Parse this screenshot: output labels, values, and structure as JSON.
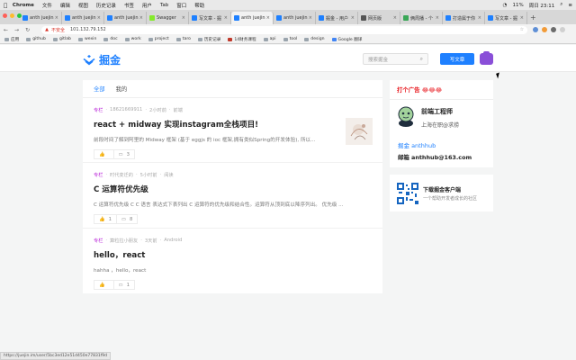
{
  "macbar": {
    "app": "Chrome",
    "menus": [
      "文件",
      "编辑",
      "视图",
      "历史记录",
      "书签",
      "用户",
      "Tab",
      "窗口",
      "帮助"
    ],
    "battery": "11%",
    "clock": "周日 23:11"
  },
  "tabs": [
    {
      "label": "anth juejin"
    },
    {
      "label": "anth juejin"
    },
    {
      "label": "anth juejin"
    },
    {
      "label": "Swagger"
    },
    {
      "label": "写文章 - 掘"
    },
    {
      "label": "anth juejin"
    },
    {
      "label": "anth juejin"
    },
    {
      "label": "掘金 - 用户"
    },
    {
      "label": "网页版"
    },
    {
      "label": "俩周播 - 个"
    },
    {
      "label": "打造属于你"
    },
    {
      "label": "写文章 - 掘"
    }
  ],
  "toolbar": {
    "security_label": "不安全",
    "url": "101.132.79.152"
  },
  "bookmarks": [
    "应用",
    "github",
    "gitlab",
    "wexin",
    "doc",
    "work",
    "project",
    "taro",
    "历史记录",
    "14财务课程",
    "api",
    "tool",
    "design",
    "Google 翻译"
  ],
  "header": {
    "logo_text": "掘金",
    "search_placeholder": "搜索掘金",
    "write_button": "写文章"
  },
  "feed": {
    "tabs": [
      "全部",
      "我的"
    ],
    "entries": [
      {
        "tag": "专栏",
        "author": "18621669911",
        "time": "2小时前",
        "category": "前端",
        "title": "react + midway 实现instagram全栈项目!",
        "abstract": "前段时间了解到阿里的 Midway 框架 (基于 eggjs 的 ioc 框架,拥有类似Spring的开发体验), 所以...",
        "likes": "",
        "comments": "3"
      },
      {
        "tag": "专栏",
        "author": "时代变迁的",
        "time": "5小时前",
        "category": "阅读",
        "title": "C 运算符优先级",
        "abstract": "C 运算符优先级 C C 语言 表达式下表列出 C 运算符的优先级和结合性。运算符从顶到底以降序列出。 优先级 ...",
        "likes": "1",
        "comments": "8"
      },
      {
        "tag": "专栏",
        "author": "算粒拉小朋友",
        "time": "3天前",
        "category": "Android",
        "title": "hello，react",
        "abstract": "hahha ，hello，react",
        "likes": "",
        "comments": "1"
      }
    ]
  },
  "sidebar": {
    "ad_heading": "打个广告 😂😂😂",
    "profile_name": "前端工程师",
    "profile_location": "上海在职@求捞",
    "juejin_line": "掘金  anthhub",
    "mail_line": "邮箱  anthhub@163.com",
    "app_title": "下载掘金客户端",
    "app_subtitle": "一个帮助开发者成长的社区"
  },
  "status_url": "https://juejin.im/user/5bc3ed12e51d450e77831f9d"
}
